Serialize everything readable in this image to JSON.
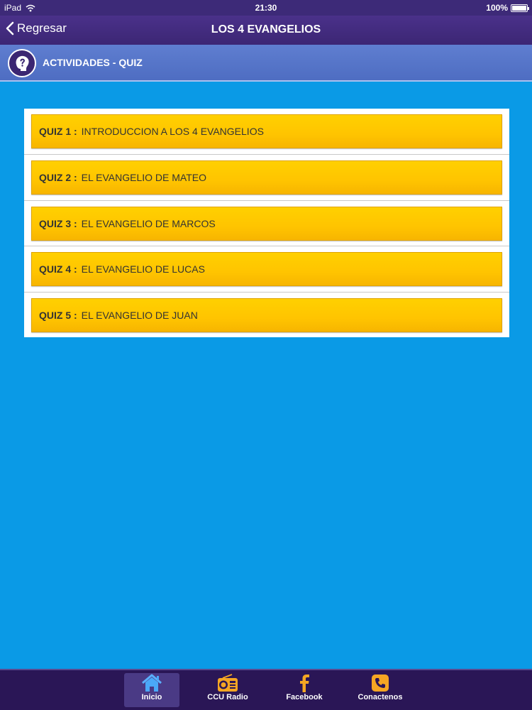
{
  "status_bar": {
    "device": "iPad",
    "time": "21:30",
    "battery": "100%"
  },
  "nav": {
    "back_label": "Regresar",
    "title": "LOS 4 EVANGELIOS"
  },
  "section": {
    "title": "ACTIVIDADES - QUIZ",
    "icon": "question-head-icon"
  },
  "quizzes": [
    {
      "number": "QUIZ 1 :",
      "title": "INTRODUCCION A LOS 4 EVANGELIOS"
    },
    {
      "number": "QUIZ 2 :",
      "title": "EL EVANGELIO  DE MATEO"
    },
    {
      "number": "QUIZ 3 :",
      "title": "EL EVANGELIO  DE MARCOS"
    },
    {
      "number": "QUIZ 4 :",
      "title": "EL EVANGELIO  DE LUCAS"
    },
    {
      "number": "QUIZ 5 :",
      "title": "EL EVANGELIO  DE JUAN"
    }
  ],
  "tabs": [
    {
      "label": "Inicio",
      "icon": "home-icon",
      "active": true
    },
    {
      "label": "CCU Radio",
      "icon": "radio-icon",
      "active": false
    },
    {
      "label": "Facebook",
      "icon": "facebook-icon",
      "active": false
    },
    {
      "label": "Conactenos",
      "icon": "phone-icon",
      "active": false
    }
  ],
  "colors": {
    "background": "#0a9ae6",
    "nav": "#3c2674",
    "quiz_button": "#ffc400",
    "tab_icon": "#f5a623"
  }
}
